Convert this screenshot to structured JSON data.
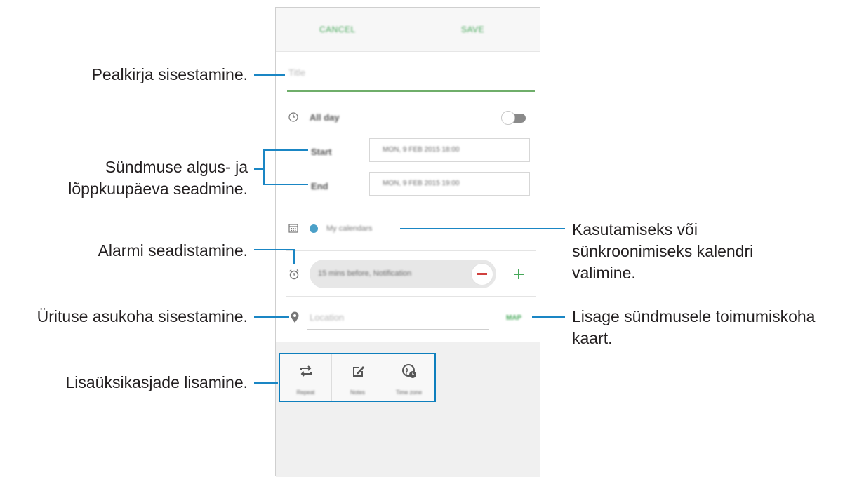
{
  "topbar": {
    "cancel_label": "CANCEL",
    "save_label": "SAVE"
  },
  "title_field": {
    "placeholder": "Title"
  },
  "all_day": {
    "label": "All day",
    "toggle_on": false
  },
  "dates": {
    "start_label": "Start",
    "start_value": "MON, 9 FEB 2015   18:00",
    "end_label": "End",
    "end_value": "MON, 9 FEB 2015   19:00"
  },
  "calendar": {
    "name": "My calendars",
    "dot_color": "#4ba0c8"
  },
  "alarm": {
    "text": "15 mins before, Notification"
  },
  "location": {
    "placeholder": "Location",
    "map_label": "MAP"
  },
  "actions": [
    {
      "label": "Repeat",
      "icon": "repeat-icon"
    },
    {
      "label": "Notes",
      "icon": "notes-icon"
    },
    {
      "label": "Time zone",
      "icon": "time-zone-icon"
    }
  ],
  "annotations": {
    "title": "Pealkirja sisestamine.",
    "dates_line1": "Sündmuse algus- ja",
    "dates_line2": "lõppkuupäeva seadmine.",
    "alarm": "Alarmi seadistamine.",
    "location": "Ürituse asukoha sisestamine.",
    "details": "Lisaüksikasjade lisamine.",
    "calendar_line1": "Kasutamiseks või",
    "calendar_line2": "sünkroonimiseks kalendri",
    "calendar_line3": "valimine.",
    "map_line1": "Lisage sündmusele toimumiskoha",
    "map_line2": "kaart."
  },
  "colors": {
    "accent_green": "#47a85a",
    "callout_blue": "#1a86c4",
    "remove_red": "#d0413e"
  }
}
